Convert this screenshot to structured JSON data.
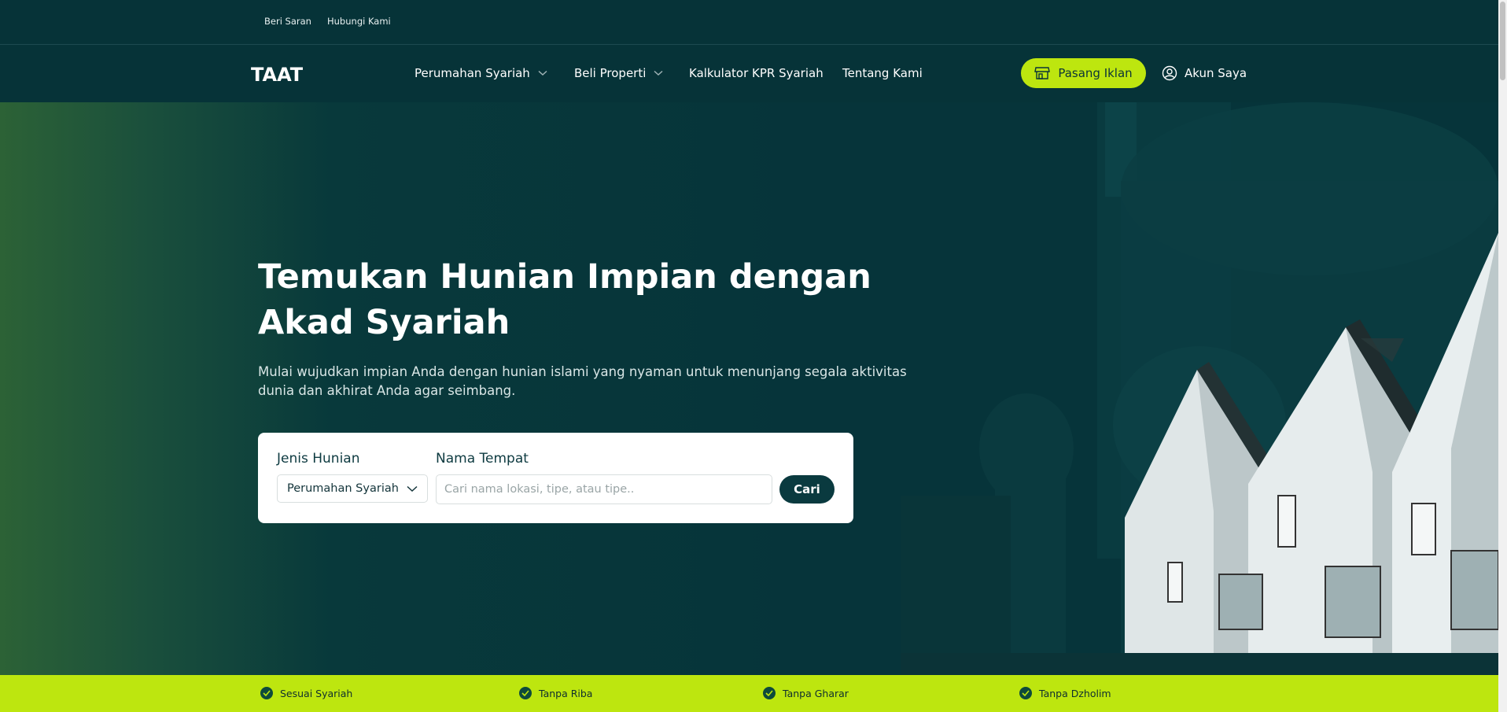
{
  "topbar": {
    "links": [
      "Beri Saran",
      "Hubungi Kami"
    ]
  },
  "nav": {
    "logo": "TAAT",
    "items": [
      {
        "label": "Perumahan Syariah",
        "dropdown": true
      },
      {
        "label": "Beli Properti",
        "dropdown": true
      },
      {
        "label": "Kalkulator KPR Syariah",
        "dropdown": false
      },
      {
        "label": "Tentang Kami",
        "dropdown": false
      }
    ],
    "pasang_iklan": "Pasang Iklan",
    "akun": "Akun Saya"
  },
  "hero": {
    "title": "Temukan Hunian Impian dengan Akad Syariah",
    "subtitle": "Mulai wujudkan impian Anda dengan hunian islami yang nyaman untuk menunjang segala aktivitas dunia dan akhirat Anda agar seimbang."
  },
  "search": {
    "jenis_label": "Jenis Hunian",
    "jenis_value": "Perumahan Syariah",
    "tempat_label": "Nama Tempat",
    "tempat_placeholder": "Cari nama lokasi, tipe, atau tipe..",
    "tempat_value": "",
    "button": "Cari"
  },
  "features": [
    "Sesuai Syariah",
    "Tanpa Riba",
    "Tanpa Gharar",
    "Tanpa Dzholim"
  ],
  "colors": {
    "accent": "#bde60f",
    "primary": "#06343a"
  }
}
